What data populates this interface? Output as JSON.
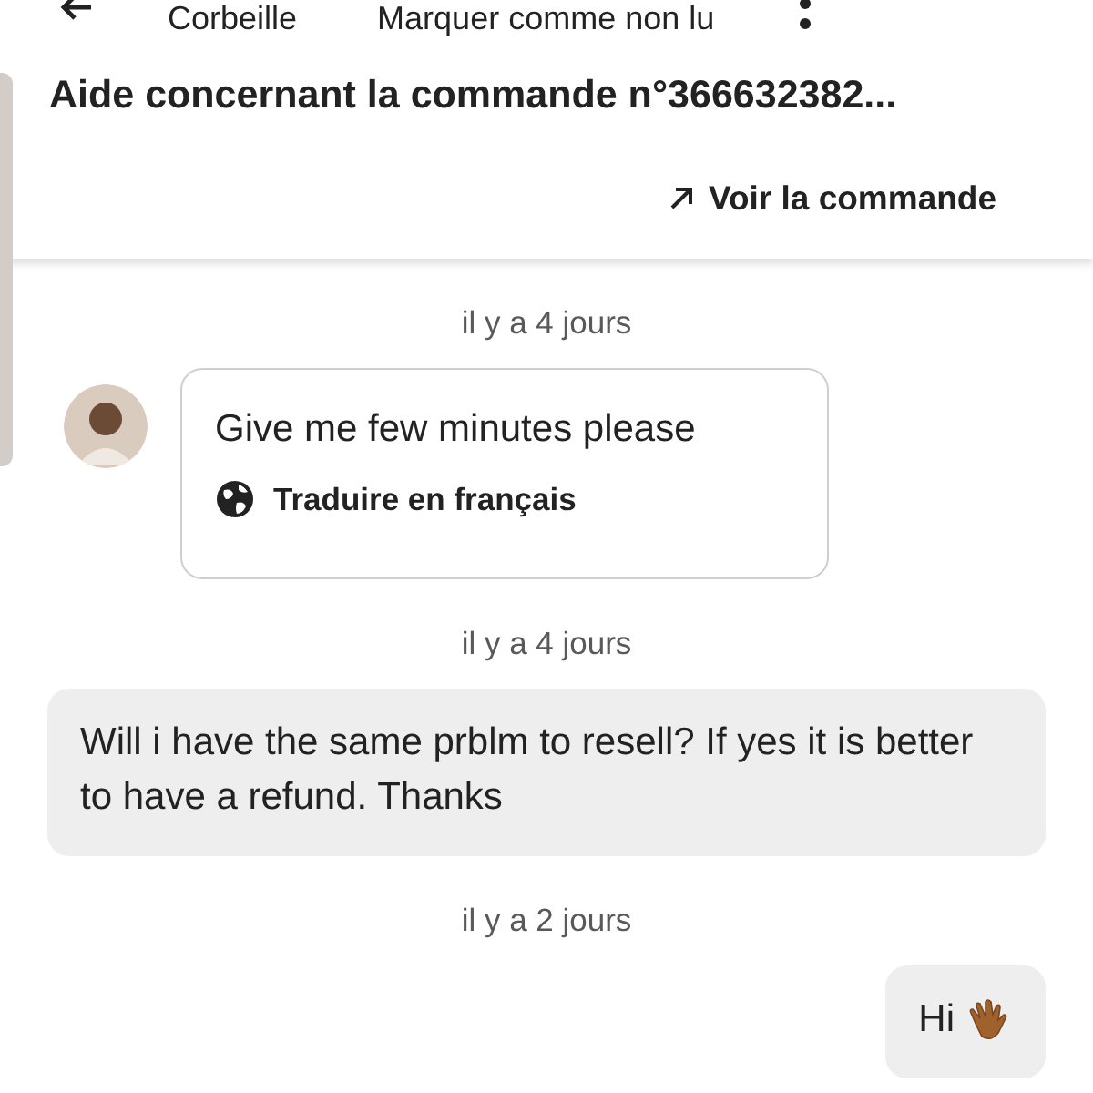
{
  "toolbar": {
    "actions": [
      "Corbeille",
      "Marquer comme non lu"
    ]
  },
  "header": {
    "title": "Aide concernant la commande n°366632382...",
    "link": "Voir la commande"
  },
  "messages": [
    {
      "kind": "time",
      "text": "il y a 4 jours"
    },
    {
      "kind": "received",
      "text": "Give me few minutes please",
      "translate": "Traduire en français"
    },
    {
      "kind": "time",
      "text": "il y a 4 jours"
    },
    {
      "kind": "sent",
      "text": "Will i have the same prblm to resell? If yes it is better to have a refund. Thanks"
    },
    {
      "kind": "time",
      "text": "il y a 2 jours"
    },
    {
      "kind": "sent_wave",
      "text": "Hi"
    }
  ]
}
